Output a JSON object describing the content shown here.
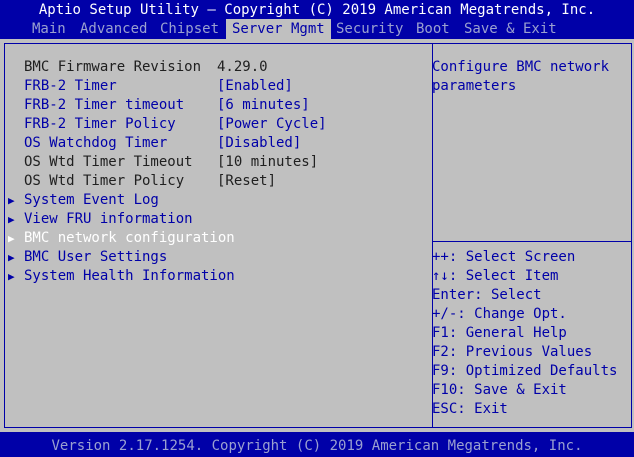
{
  "title": "Aptio Setup Utility – Copyright (C) 2019 American Megatrends, Inc.",
  "menu": [
    "Main",
    "Advanced",
    "Chipset",
    "Server Mgmt",
    "Security",
    "Boot",
    "Save & Exit"
  ],
  "active_menu": "Server Mgmt",
  "settings": [
    {
      "label": "BMC Firmware Revision",
      "value": "4.29.0"
    },
    {
      "label": "FRB-2 Timer",
      "value": "[Enabled]"
    },
    {
      "label": "FRB-2 Timer timeout",
      "value": "[6 minutes]"
    },
    {
      "label": "FRB-2 Timer Policy",
      "value": "[Power Cycle]"
    },
    {
      "label": "OS Watchdog Timer",
      "value": "[Disabled]"
    },
    {
      "label": "OS Wtd Timer Timeout",
      "value": "[10 minutes]"
    },
    {
      "label": "OS Wtd Timer Policy",
      "value": "[Reset]"
    }
  ],
  "submenus": [
    "System Event Log",
    "View FRU information",
    "BMC network configuration",
    "BMC User Settings",
    "System Health Information"
  ],
  "help_text": [
    "Configure BMC network",
    "parameters"
  ],
  "key_help": [
    "++: Select Screen",
    "↑↓: Select Item",
    "Enter: Select",
    "+/-: Change Opt.",
    "F1: General Help",
    "F2: Previous Values",
    "F9: Optimized Defaults",
    "F10: Save & Exit",
    "ESC: Exit"
  ],
  "footer": "Version 2.17.1254. Copyright (C) 2019 American Megatrends, Inc."
}
